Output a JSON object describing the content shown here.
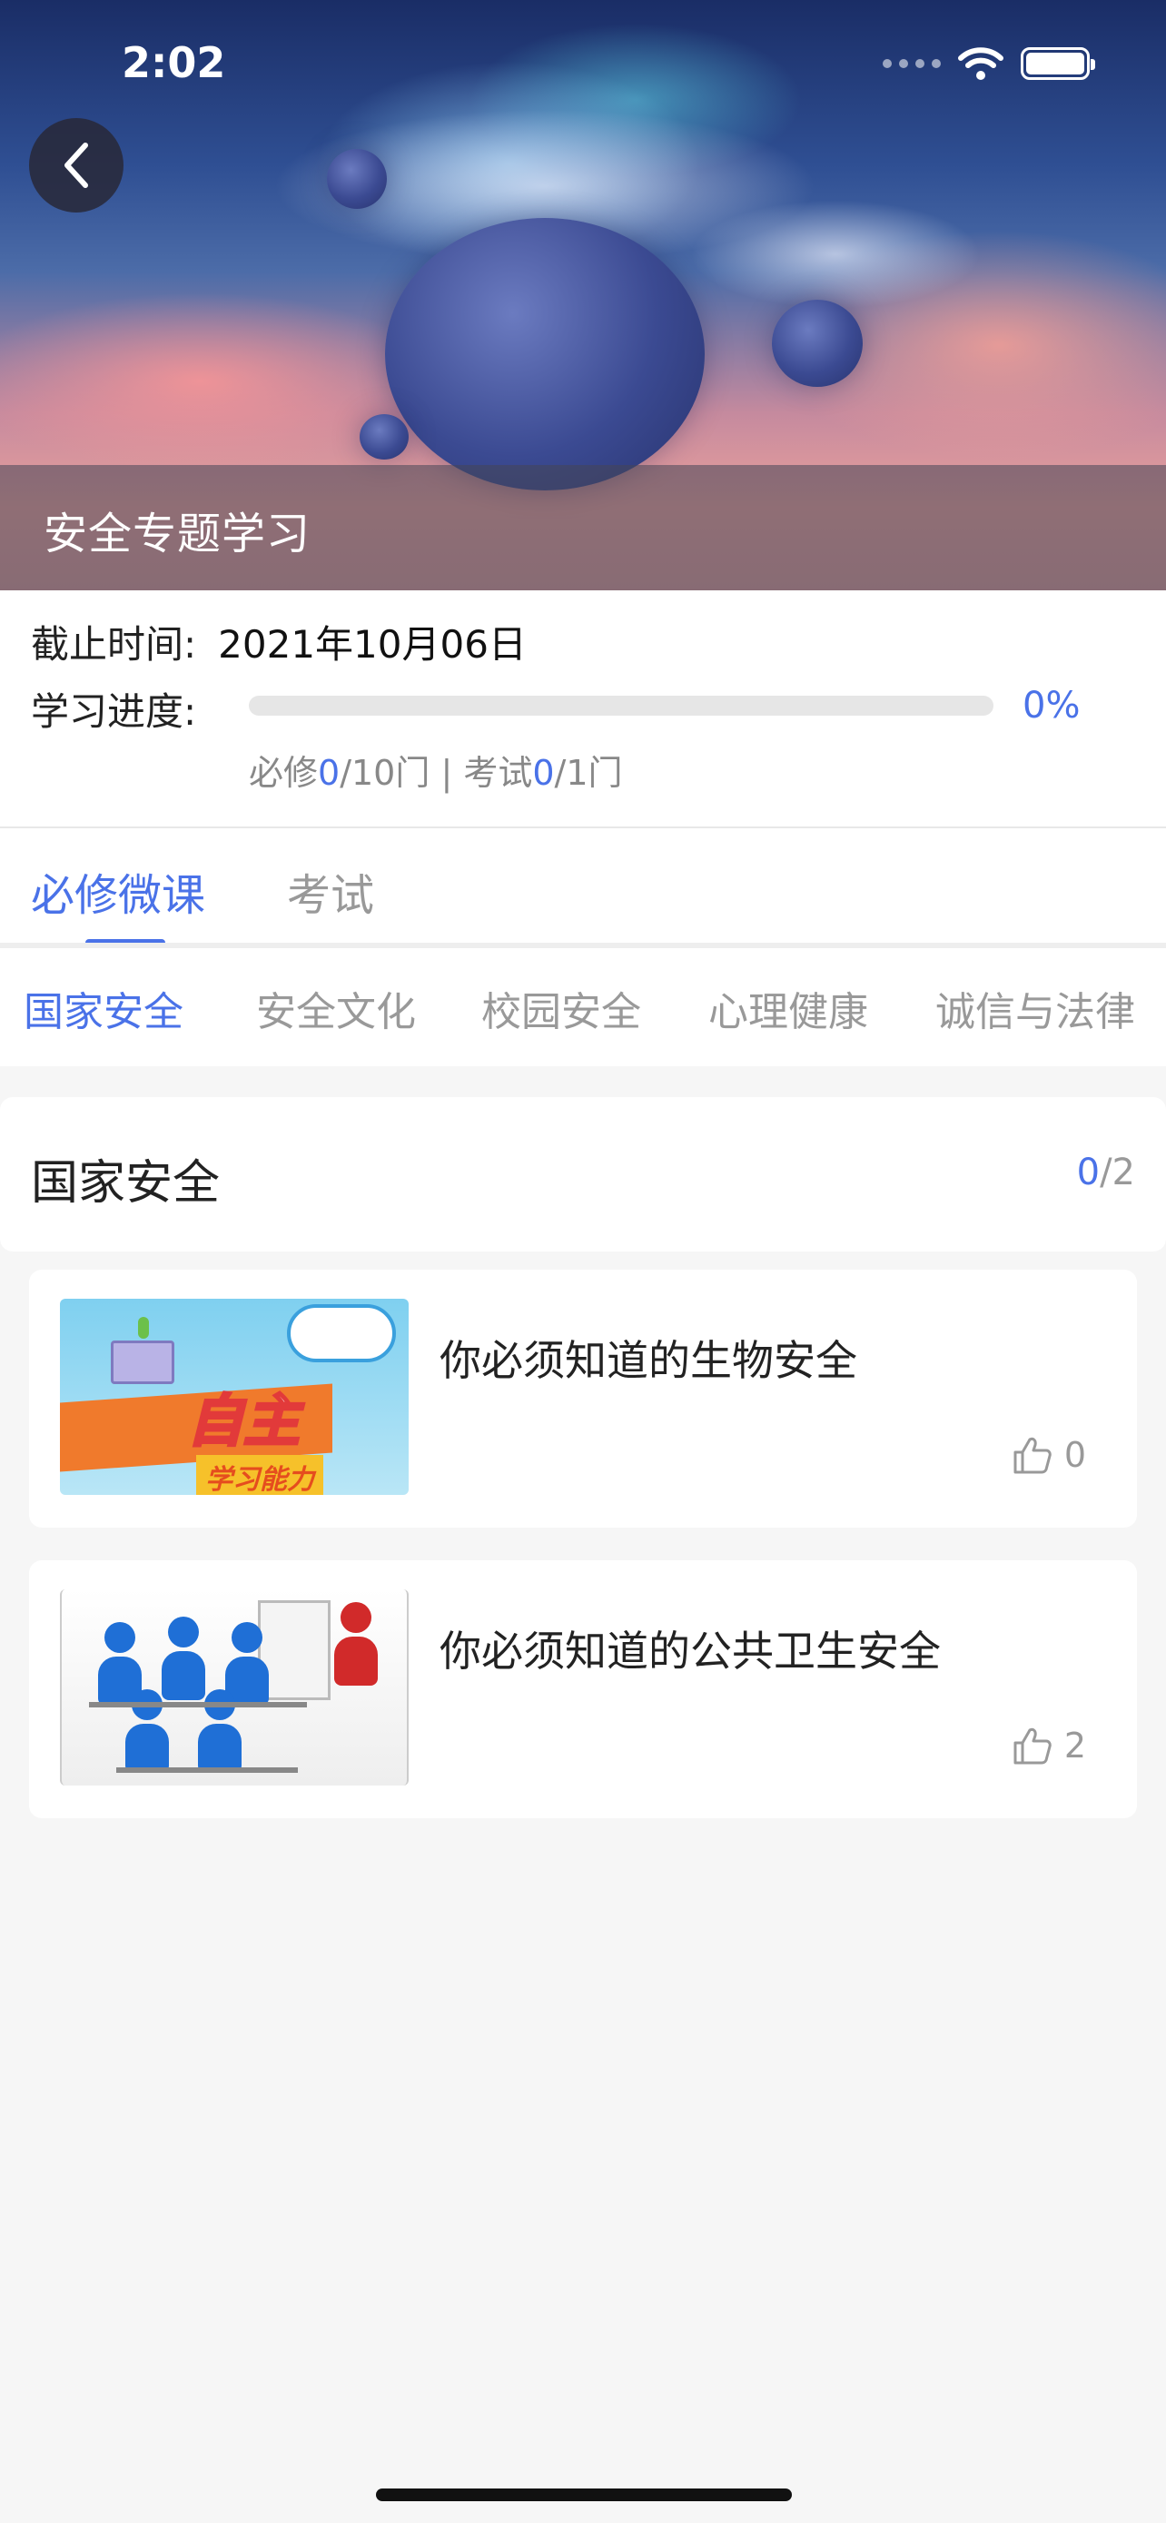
{
  "status_bar": {
    "time": "2:02"
  },
  "hero": {
    "title": "安全专题学习"
  },
  "info": {
    "deadline_label": "截止时间:",
    "deadline_value": "2021年10月06日",
    "progress_label": "学习进度:",
    "progress_percent_text": "0%",
    "progress_fraction": 0,
    "required_prefix": "必修",
    "required_done": "0",
    "required_total": "/10门",
    "separator": " | ",
    "exam_prefix": "考试",
    "exam_done": "0",
    "exam_total": "/1门"
  },
  "main_tabs": [
    {
      "label": "必修微课",
      "active": true
    },
    {
      "label": "考试",
      "active": false
    }
  ],
  "category_tabs": [
    {
      "label": "国家安全",
      "active": true
    },
    {
      "label": "安全文化",
      "active": false
    },
    {
      "label": "校园安全",
      "active": false
    },
    {
      "label": "心理健康",
      "active": false
    },
    {
      "label": "诚信与法律",
      "active": false
    }
  ],
  "section": {
    "title": "国家安全",
    "done": "0",
    "total": "/2"
  },
  "courses": [
    {
      "title": "你必须知道的生物安全",
      "likes": "0",
      "thumb_text_main": "自主",
      "thumb_text_sub": "学习能力"
    },
    {
      "title": "你必须知道的公共卫生安全",
      "likes": "2"
    }
  ],
  "colors": {
    "accent": "#4a72e8",
    "muted": "#999999",
    "background": "#f6f6f6"
  }
}
